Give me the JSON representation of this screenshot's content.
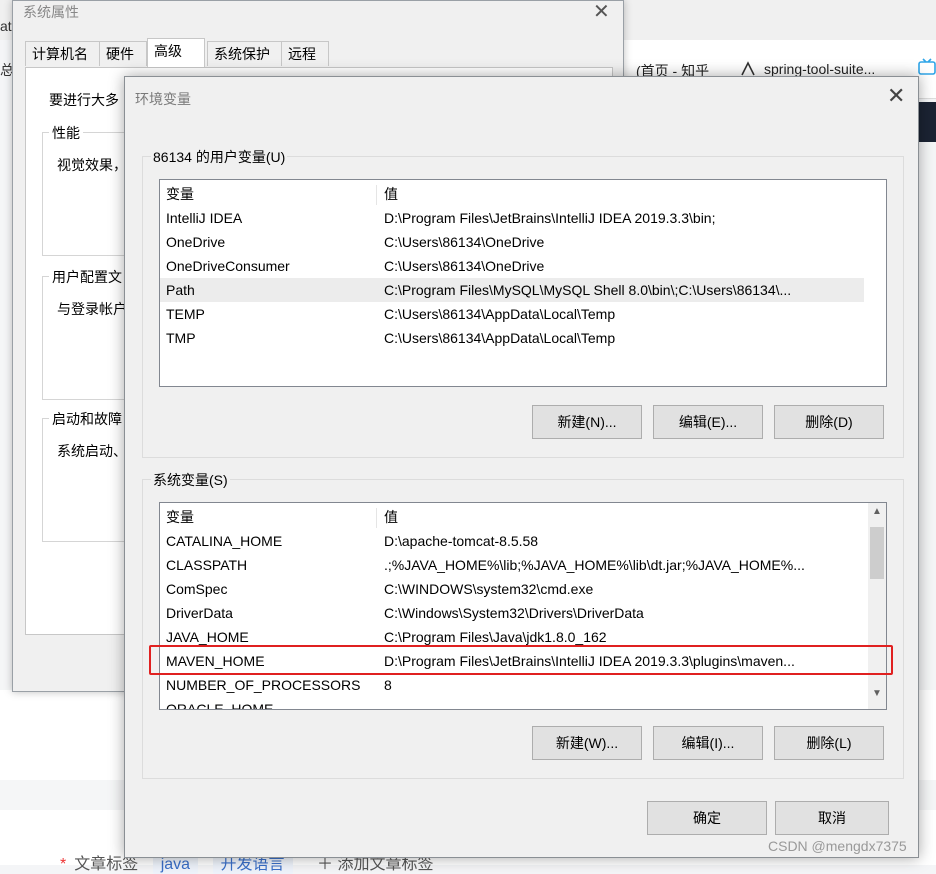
{
  "background": {
    "tabs": [
      {
        "label": "(首页 - 知乎"
      },
      {
        "label": "spring-tool-suite..."
      }
    ],
    "left_fragments": [
      "at",
      "总"
    ],
    "tags": {
      "label": "文章标签",
      "tag1": "java",
      "tag2": "开发语言",
      "add": "添加文章标签"
    },
    "watermark": "CSDN @mengdx7375"
  },
  "system_properties": {
    "title": "系统属性",
    "tabs": [
      "计算机名",
      "硬件",
      "高级",
      "系统保护",
      "远程"
    ],
    "active_tab": "高级",
    "intro": "要进行大多",
    "groups": [
      {
        "title": "性能",
        "text": "视觉效果，"
      },
      {
        "title": "用户配置文",
        "text": "与登录帐户"
      },
      {
        "title": "启动和故障",
        "text": "系统启动、"
      }
    ]
  },
  "env_vars": {
    "title": "环境变量",
    "user_group_title": "86134 的用户变量(U)",
    "columns": {
      "name": "变量",
      "value": "值"
    },
    "user_vars": [
      {
        "name": "IntelliJ IDEA",
        "value": "D:\\Program Files\\JetBrains\\IntelliJ IDEA 2019.3.3\\bin;"
      },
      {
        "name": "OneDrive",
        "value": "C:\\Users\\86134\\OneDrive"
      },
      {
        "name": "OneDriveConsumer",
        "value": "C:\\Users\\86134\\OneDrive"
      },
      {
        "name": "Path",
        "value": "C:\\Program Files\\MySQL\\MySQL Shell 8.0\\bin\\;C:\\Users\\86134\\..."
      },
      {
        "name": "TEMP",
        "value": "C:\\Users\\86134\\AppData\\Local\\Temp"
      },
      {
        "name": "TMP",
        "value": "C:\\Users\\86134\\AppData\\Local\\Temp"
      }
    ],
    "user_buttons": {
      "new": "新建(N)...",
      "edit": "编辑(E)...",
      "delete": "删除(D)"
    },
    "system_group_title": "系统变量(S)",
    "system_vars": [
      {
        "name": "CATALINA_HOME",
        "value": "D:\\apache-tomcat-8.5.58"
      },
      {
        "name": "CLASSPATH",
        "value": ".;%JAVA_HOME%\\lib;%JAVA_HOME%\\lib\\dt.jar;%JAVA_HOME%..."
      },
      {
        "name": "ComSpec",
        "value": "C:\\WINDOWS\\system32\\cmd.exe"
      },
      {
        "name": "DriverData",
        "value": "C:\\Windows\\System32\\Drivers\\DriverData"
      },
      {
        "name": "JAVA_HOME",
        "value": "C:\\Program Files\\Java\\jdk1.8.0_162"
      },
      {
        "name": "MAVEN_HOME",
        "value": "D:\\Program Files\\JetBrains\\IntelliJ IDEA 2019.3.3\\plugins\\maven..."
      },
      {
        "name": "NUMBER_OF_PROCESSORS",
        "value": "8"
      },
      {
        "name": "ORACLE_HOME",
        "value": ""
      }
    ],
    "system_buttons": {
      "new": "新建(W)...",
      "edit": "编辑(I)...",
      "delete": "删除(L)"
    },
    "ok": "确定",
    "cancel": "取消",
    "highlight_color": "#e02020"
  }
}
